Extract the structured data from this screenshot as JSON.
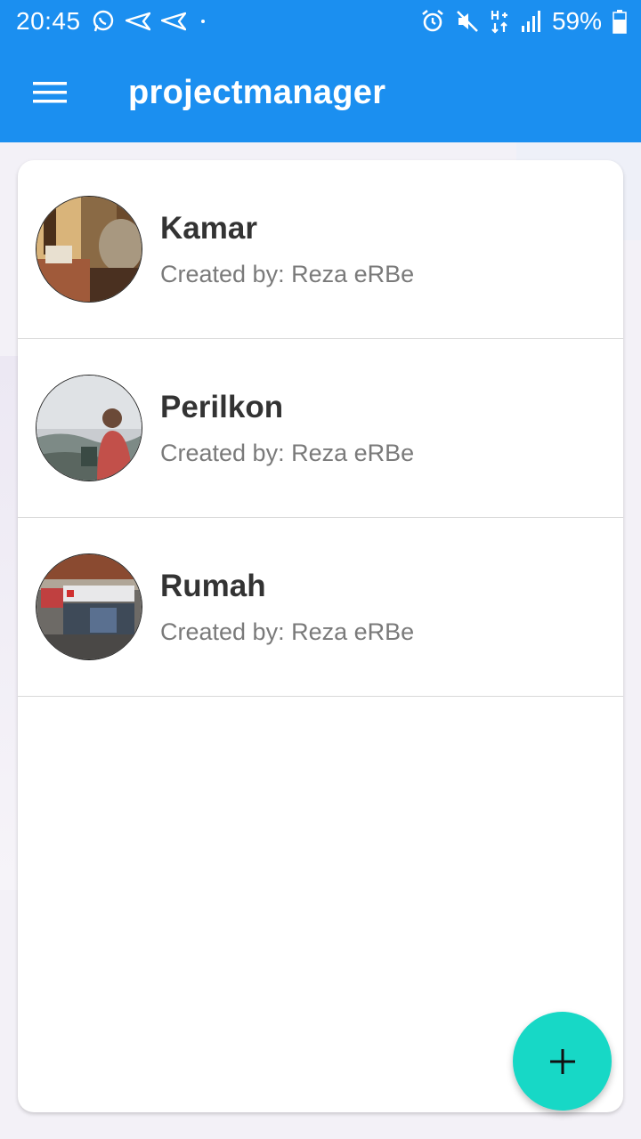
{
  "status_bar": {
    "time": "20:45",
    "battery_percent": "59%",
    "icons_left": [
      "whatsapp-icon",
      "telegram-icon",
      "telegram-icon",
      "dot-icon"
    ],
    "icons_right": [
      "alarm-icon",
      "mute-icon",
      "network-h-plus-icon",
      "signal-icon",
      "battery-icon"
    ]
  },
  "app_bar": {
    "title": "projectmanager",
    "menu_icon": "hamburger-menu-icon"
  },
  "projects": [
    {
      "title": "Kamar",
      "subtitle": "Created by: Reza eRBe"
    },
    {
      "title": "Perilkon",
      "subtitle": "Created by: Reza eRBe"
    },
    {
      "title": "Rumah",
      "subtitle": "Created by: Reza eRBe"
    }
  ],
  "fab": {
    "icon": "plus-icon"
  },
  "colors": {
    "primary": "#1b8ff0",
    "fab": "#17d8c6",
    "title_text": "#333333",
    "subtitle_text": "#7a7a7a"
  }
}
